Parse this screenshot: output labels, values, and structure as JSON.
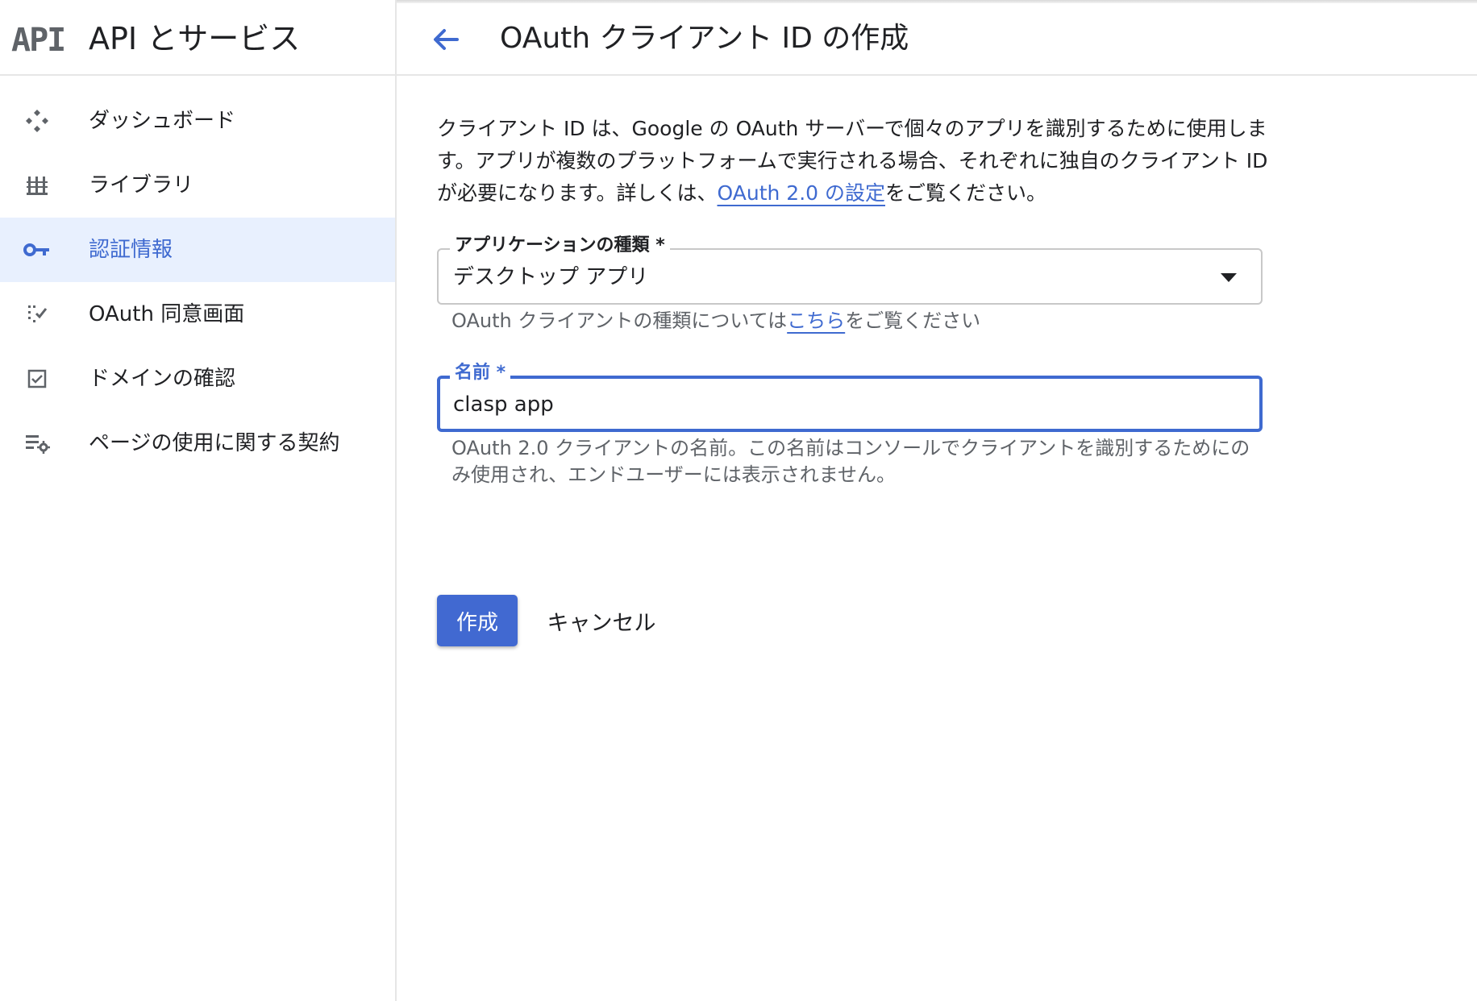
{
  "sidebar": {
    "logo": "API",
    "title": "API とサービス",
    "items": [
      {
        "label": "ダッシュボード",
        "icon": "dashboard-icon"
      },
      {
        "label": "ライブラリ",
        "icon": "library-icon"
      },
      {
        "label": "認証情報",
        "icon": "key-icon",
        "active": true
      },
      {
        "label": "OAuth 同意画面",
        "icon": "consent-screen-icon"
      },
      {
        "label": "ドメインの確認",
        "icon": "checkbox-icon"
      },
      {
        "label": "ページの使用に関する契約",
        "icon": "settings-list-icon"
      }
    ]
  },
  "header": {
    "title": "OAuth クライアント ID の作成",
    "back_icon": "arrow-back-icon"
  },
  "intro": {
    "text": "クライアント ID は、Google の OAuth サーバーで個々のアプリを識別するために使用します。アプリが複数のプラットフォームで実行される場合、それぞれに独自のクライアント ID が必要になります。詳しくは、",
    "link": "OAuth 2.0 の設定",
    "suffix": "をご覧ください。"
  },
  "form": {
    "app_type": {
      "label": "アプリケーションの種類 *",
      "value": "デスクトップ アプリ",
      "hint_prefix": "OAuth クライアントの種類については",
      "hint_link": "こちら",
      "hint_suffix": "をご覧ください"
    },
    "name": {
      "label": "名前 *",
      "value": "clasp app",
      "hint": "OAuth 2.0 クライアントの名前。この名前はコンソールでクライアントを識別するためにのみ使用され、エンドユーザーには表示されません。"
    }
  },
  "actions": {
    "create": "作成",
    "cancel": "キャンセル"
  },
  "colors": {
    "accent": "#3f6ad0",
    "primary_button": "#4169d1",
    "active_nav_bg": "#e8f0fe"
  }
}
